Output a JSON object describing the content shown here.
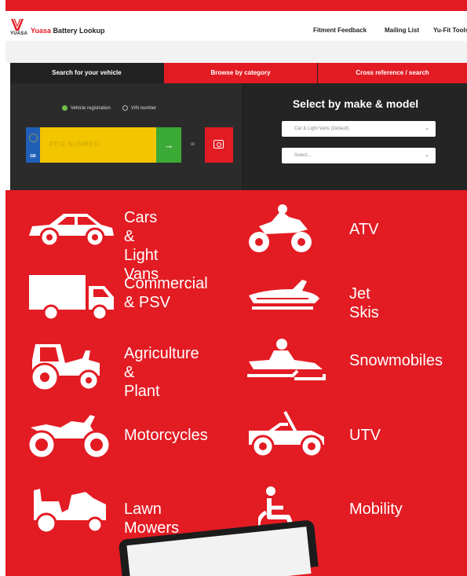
{
  "header": {
    "brand_name": "Yuasa",
    "brand_rest": " Battery Lookup",
    "logo_word": "YUASA",
    "nav": [
      "Fitment Feedback",
      "Mailing List",
      "Yu-Fit Tools"
    ]
  },
  "search": {
    "tabs": [
      "Search for your vehicle",
      "Browse by category",
      "Cross reference / search"
    ],
    "radio_options": [
      "Vehicle registration",
      "VIN number"
    ],
    "plate_country": "GB",
    "plate_placeholder": "REG NUMBER",
    "go_icon": "→",
    "or_text": "or",
    "make_title": "Select by make & model",
    "select1_value": "Car & Light Vans (Default)",
    "select2_value": "Select..."
  },
  "categories": [
    {
      "label_lines": [
        "Cars &",
        "Light Vans"
      ],
      "icon": "car-icon"
    },
    {
      "label_lines": [
        "ATV"
      ],
      "icon": "atv-icon"
    },
    {
      "label_lines": [
        "Commercial",
        "& PSV"
      ],
      "icon": "truck-icon"
    },
    {
      "label_lines": [
        "Jet Skis"
      ],
      "icon": "jet-ski-icon"
    },
    {
      "label_lines": [
        "Agriculture &",
        "Plant"
      ],
      "icon": "tractor-icon"
    },
    {
      "label_lines": [
        "Snowmobiles"
      ],
      "icon": "snowmobile-icon"
    },
    {
      "label_lines": [
        "Motorcycles"
      ],
      "icon": "motorcycle-icon"
    },
    {
      "label_lines": [
        "UTV"
      ],
      "icon": "utv-icon"
    },
    {
      "label_lines": [
        "Lawn Mowers"
      ],
      "icon": "lawn-mower-icon"
    },
    {
      "label_lines": [
        "Mobility"
      ],
      "icon": "wheelchair-icon"
    }
  ],
  "colors": {
    "brand_red": "#e31b23",
    "dark": "#222222",
    "plate_yellow": "#f2c500",
    "eu_blue": "#1f5fb8",
    "go_green": "#3aa935"
  }
}
